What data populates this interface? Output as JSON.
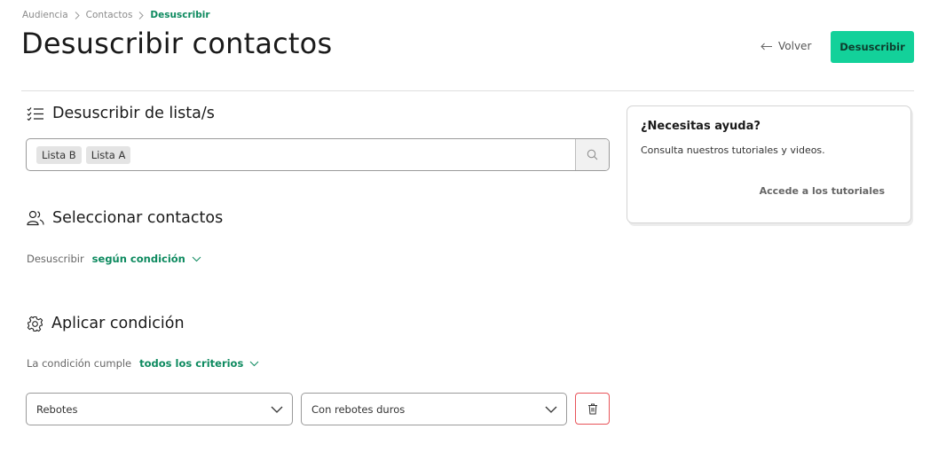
{
  "breadcrumb": {
    "items": [
      "Audiencia",
      "Contactos"
    ],
    "current": "Desuscribir"
  },
  "header": {
    "title": "Desuscribir contactos",
    "back_label": "Volver",
    "primary_label": "Desuscribir"
  },
  "lists_section": {
    "title": "Desuscribir de lista/s",
    "selected_lists": [
      "Lista B",
      "Lista A"
    ]
  },
  "contacts_section": {
    "title": "Seleccionar contactos",
    "mode_label": "Desuscribir",
    "mode_value": "según condición"
  },
  "condition_section": {
    "title": "Aplicar condición",
    "match_label": "La condición cumple",
    "match_value": "todos los criterios",
    "rule": {
      "field": "Rebotes",
      "operator": "Con rebotes duros"
    }
  },
  "help": {
    "title": "¿Necesitas ayuda?",
    "text": "Consulta nuestros tutoriales y videos.",
    "link": "Accede a los tutoriales"
  },
  "colors": {
    "accent": "#13d19a",
    "accent_text": "#0d8a5f",
    "danger": "#e8545a"
  }
}
